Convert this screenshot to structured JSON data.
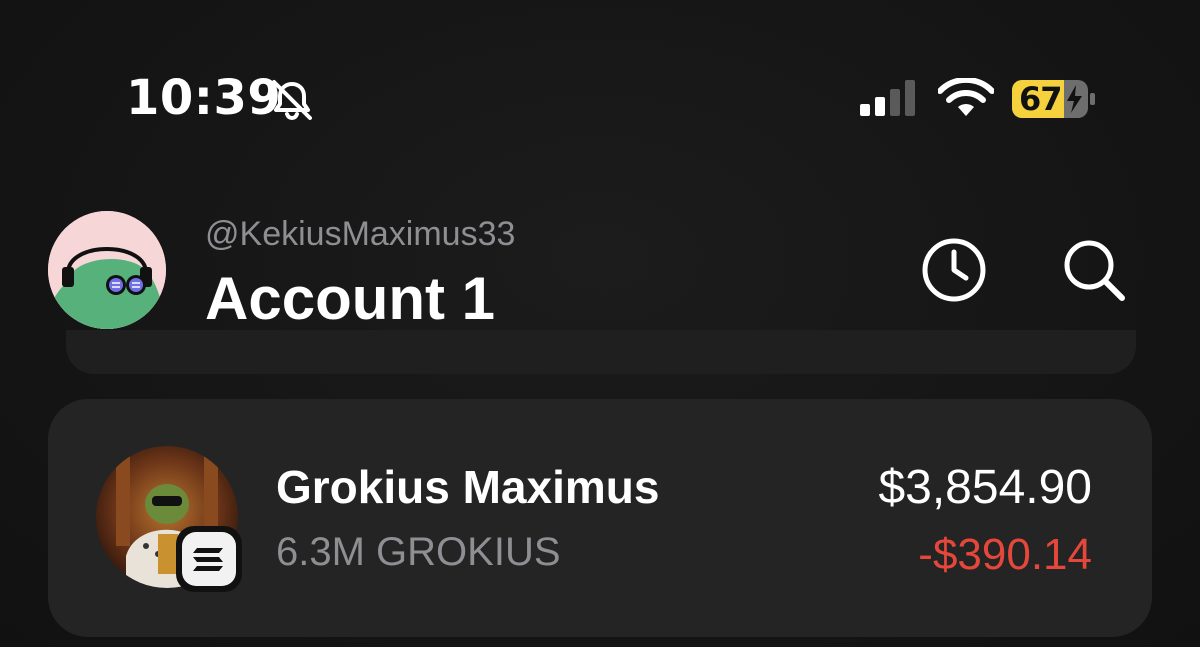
{
  "status_bar": {
    "time": "10:39",
    "battery_percent": "67",
    "icons": [
      "bell-slash-icon",
      "cellular-signal-icon",
      "wifi-icon",
      "battery-charging-icon"
    ],
    "battery_color": "#f4d13d"
  },
  "header": {
    "handle": "@KekiusMaximus33",
    "account_name": "Account 1",
    "buttons": [
      "history-clock-icon",
      "search-icon"
    ]
  },
  "tokens": [
    {
      "name": "Grokius Maximus",
      "amount": "6.3M GROKIUS",
      "value": "$3,854.90",
      "change": "-$390.14",
      "change_color": "#e5483a",
      "chain_badge_icon": "solana-icon"
    }
  ],
  "colors": {
    "background": "#141414",
    "card": "#242424",
    "secondary_text": "#8e8e93"
  }
}
